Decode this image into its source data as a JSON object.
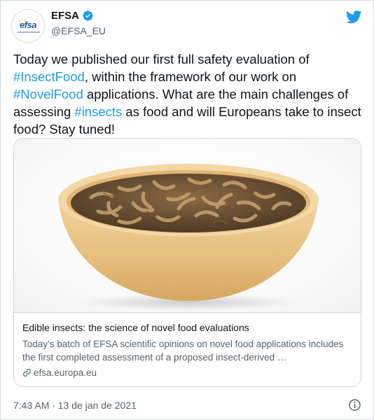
{
  "author": {
    "display_name": "EFSA",
    "handle": "@EFSA_EU",
    "avatar_logo_text": "efsa",
    "verified": true,
    "verified_icon": "verified-badge-icon"
  },
  "platform_icon": "twitter-bird-icon",
  "tweet": {
    "text_1": "Today we published our first full safety evaluation of ",
    "hashtag_1": "#InsectFood",
    "text_2": ", within the framework of our work on ",
    "hashtag_2": "#NovelFood",
    "text_3": " applications. What are the main challenges of assessing ",
    "hashtag_3": "#insects",
    "text_4": " as food and will Europeans take to insect food? Stay tuned!"
  },
  "card": {
    "image_description_icon": "bowl-of-mealworms-image",
    "title": "Edible insects: the science of novel food evaluations",
    "description": "Today’s batch of EFSA scientific opinions on novel food applications includes the first completed assessment of a proposed insect-derived …",
    "domain": "efsa.europa.eu",
    "domain_icon": "link-icon"
  },
  "footer": {
    "timestamp": "7:43 AM · 13 de jan de 2021",
    "info_icon": "info-icon"
  },
  "colors": {
    "link_blue": "#1d9bf0",
    "text_primary": "#0f1419",
    "text_secondary": "#536471",
    "border": "#cfd9de",
    "efsa_blue": "#1b5e9e",
    "bowl": "#e9c58a"
  }
}
